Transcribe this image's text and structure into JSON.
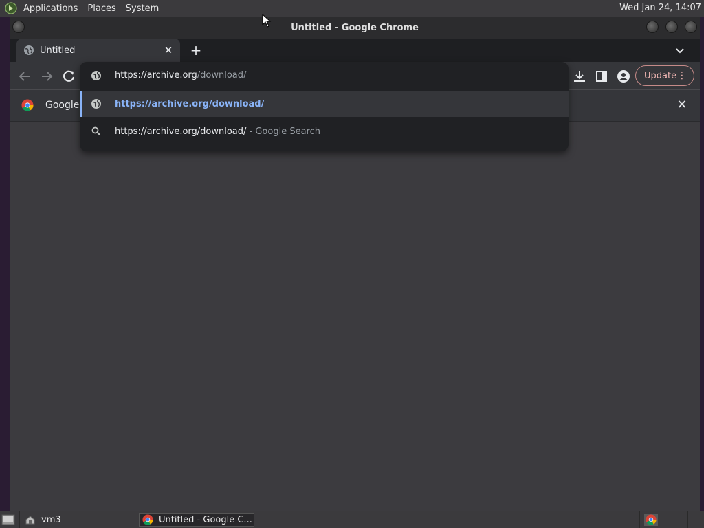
{
  "top_panel": {
    "menus": [
      "Applications",
      "Places",
      "System"
    ],
    "clock": "Wed Jan 24, 14:07"
  },
  "window": {
    "title": "Untitled - Google Chrome"
  },
  "tabs": [
    {
      "label": "Untitled",
      "icon": "globe-icon"
    }
  ],
  "toolbar": {
    "update_label": "Update"
  },
  "infobar": {
    "text": "Google"
  },
  "omnibox": {
    "input_host": "https://archive.org",
    "input_path": "/download/",
    "suggestions": [
      {
        "icon": "globe-icon",
        "text": "https://archive.org/download/",
        "suffix": ""
      },
      {
        "icon": "search-icon",
        "text": "https://archive.org/download/",
        "suffix": "- Google Search"
      }
    ]
  },
  "taskbar": {
    "items": [
      {
        "label": "vm3",
        "icon": "home-folder-icon"
      },
      {
        "label": "Untitled - Google C...",
        "icon": "chrome-icon"
      }
    ]
  },
  "colors": {
    "accent_link": "#8ab4f8",
    "update_accent": "#f2b8b5"
  }
}
